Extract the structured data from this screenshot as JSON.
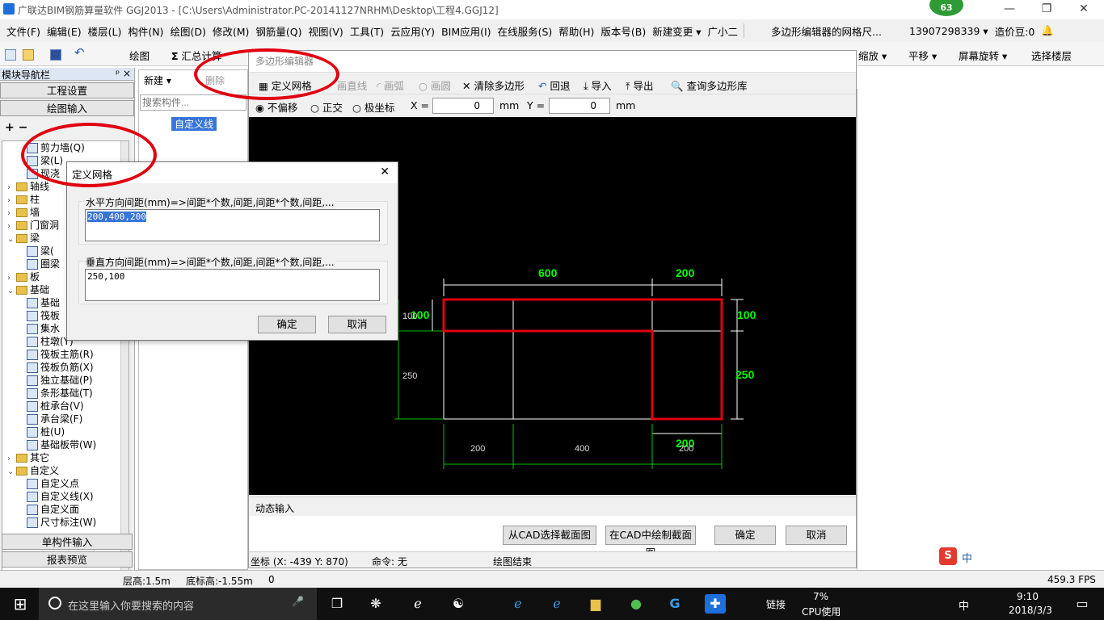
{
  "window": {
    "title": "广联达BIM钢筋算量软件 GGJ2013 - [C:\\Users\\Administrator.PC-20141127NRHM\\Desktop\\工程4.GGJ12]",
    "badge": "63",
    "min": "—",
    "max": "❐",
    "close": "✕"
  },
  "menubar": {
    "items": [
      "文件(F)",
      "编辑(E)",
      "楼层(L)",
      "构件(N)",
      "绘图(D)",
      "修改(M)",
      "钢筋量(Q)",
      "视图(V)",
      "工具(T)",
      "云应用(Y)",
      "BIM应用(I)",
      "在线服务(S)",
      "帮助(H)",
      "版本号(B)",
      "新建变更 ▾",
      "广小二"
    ],
    "notice": "多边形编辑器的网格尺...",
    "phone": "13907298339 ▾",
    "cost": "造价豆:0",
    "bell": "🔔"
  },
  "toolbar": {
    "draw": "绘图",
    "sum": "汇总计算",
    "zoom": "缩放 ▾",
    "pan": "平移 ▾",
    "rotate": "屏幕旋转 ▾",
    "floor": "选择楼层"
  },
  "leftpanel": {
    "title": "模块导航栏",
    "pin": "ᵖ ×",
    "btn_project": "工程设置",
    "btn_draw": "绘图输入",
    "btn_single": "单构件输入",
    "btn_report": "报表预览",
    "tree": [
      "剪力墙(Q)",
      "梁(L)",
      "现浇",
      "轴线",
      "柱",
      "墙",
      "门窗洞",
      "梁",
      "梁(",
      "圈梁",
      "板",
      "基础",
      "基础",
      "筏板",
      "集水",
      "柱墩(Y)",
      "筏板主筋(R)",
      "筏板负筋(X)",
      "独立基础(P)",
      "条形基础(T)",
      "桩承台(V)",
      "承台梁(F)",
      "桩(U)",
      "基础板带(W)",
      "其它",
      "自定义",
      "自定义点",
      "自定义线(X)",
      "自定义面",
      "尺寸标注(W)"
    ]
  },
  "complist": {
    "new": "新建 ▾",
    "delete": "删除",
    "search_placeholder": "搜索构件...",
    "item": "自定义线"
  },
  "editor": {
    "title": "多边形编辑器",
    "define_grid": "定义网格",
    "line": "画直线",
    "arc": "画弧",
    "circle": "画圆",
    "clear": "清除多边形",
    "undo": "回退",
    "import": "导入",
    "export": "导出",
    "query": "查询多边形库",
    "mode_none": "不偏移",
    "mode_ortho": "正交",
    "mode_polar": "极坐标",
    "x_label": "X =",
    "x_value": "0",
    "y_label": "Y =",
    "y_value": "0",
    "unit": "mm",
    "dim_top1": "600",
    "dim_top2": "200",
    "dim_right1": "100",
    "dim_right2": "250",
    "dim_left1": "100",
    "dim_left2": "250",
    "dim_bottom1": "200",
    "dim_bottom2": "400",
    "dim_bottom3": "200",
    "dim_bottom_overlay": "200",
    "dynamic": "动态输入",
    "cad_select": "从CAD选择截面图",
    "cad_draw": "在CAD中绘制截面图",
    "ok": "确定",
    "cancel": "取消",
    "coord": "坐标 (X: -439 Y: 870)",
    "command": "命令: 无",
    "state": "绘图结束"
  },
  "griddlg": {
    "title": "定义网格",
    "h_label": "水平方向间距(mm)=>间距*个数,间距,间距*个数,间距,...",
    "h_value": "200,400,200",
    "v_label": "垂直方向间距(mm)=>间距*个数,间距,间距*个数,间距,...",
    "v_value": "250,100",
    "ok": "确定",
    "cancel": "取消",
    "close": "✕"
  },
  "statusbar": {
    "floor_h": "层高:1.5m",
    "base_h": "底标高:-1.55m",
    "zero": "0",
    "fps": "459.3 FPS"
  },
  "taskbar": {
    "search": "在这里输入你要搜索的内容",
    "link": "链接",
    "cpu_pct": "7%",
    "cpu": "CPU使用",
    "ime": "中",
    "time": "9:10",
    "date": "2018/3/3"
  },
  "colors": {
    "accent": "#0078d7",
    "highlight": "#e00010",
    "dim_green": "#00ff00"
  }
}
